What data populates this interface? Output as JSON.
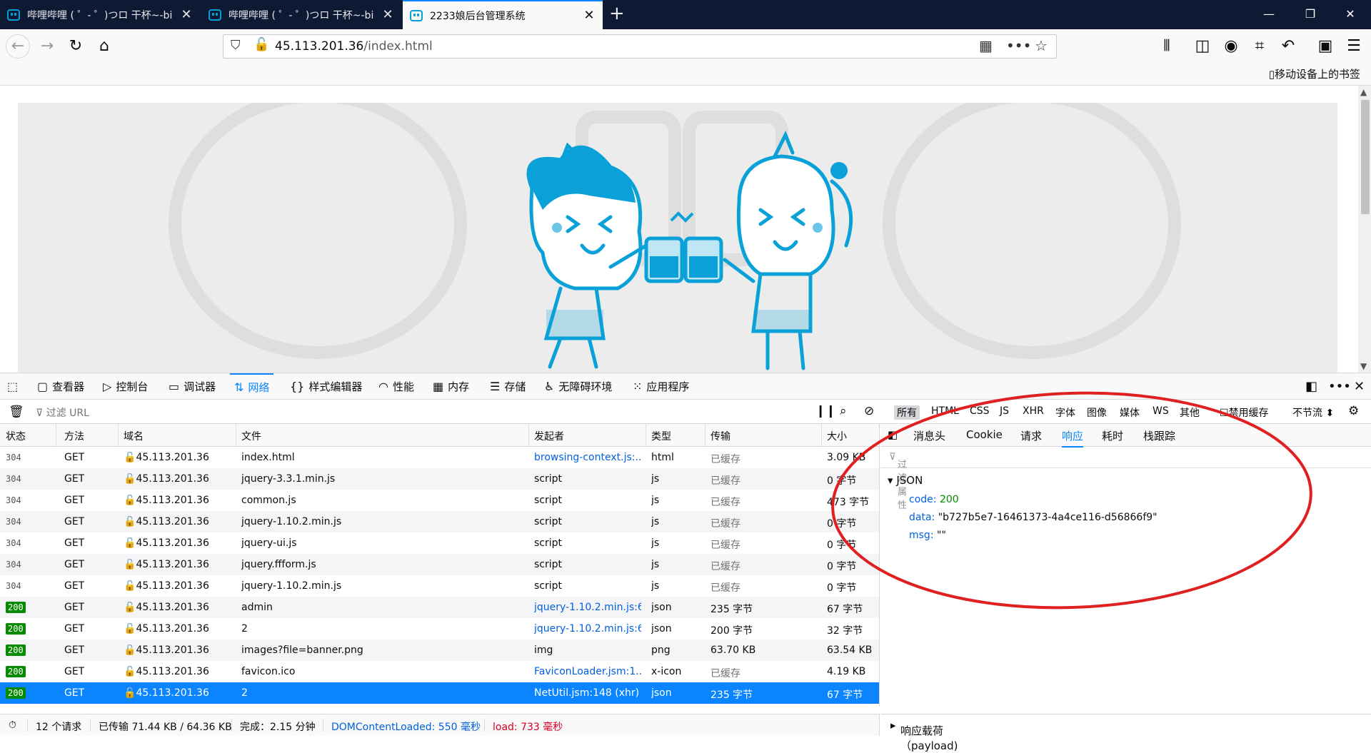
{
  "tabs": [
    {
      "title": "哔哩哔哩 ( ゜- ゜)つロ 干杯~-bi",
      "close": "✕"
    },
    {
      "title": "哔哩哔哩 ( ゜- ゜)つロ 干杯~-bi",
      "close": "✕"
    },
    {
      "title": "2233娘后台管理系统",
      "close": "✕"
    }
  ],
  "window_controls": {
    "minimize": "—",
    "restore": "❐",
    "close": "✕"
  },
  "nav": {
    "url_host": "45.113.201.36",
    "url_path": "/index.html"
  },
  "bookmarks": {
    "mobile": "移动设备上的书签"
  },
  "devtools": {
    "tabs": [
      "查看器",
      "控制台",
      "调试器",
      "网络",
      "样式编辑器",
      "性能",
      "内存",
      "存储",
      "无障碍环境",
      "应用程序"
    ],
    "filter_placeholder": "过滤 URL",
    "type_filters": [
      "所有",
      "HTML",
      "CSS",
      "JS",
      "XHR",
      "字体",
      "图像",
      "媒体",
      "WS",
      "其他"
    ],
    "disable_cache": "禁用缓存",
    "throttle": "不节流 ⬍",
    "columns": [
      "状态",
      "方法",
      "域名",
      "文件",
      "发起者",
      "类型",
      "传输",
      "大小"
    ],
    "requests": [
      {
        "status": "304",
        "method": "GET",
        "domain": "45.113.201.36",
        "file": "index.html",
        "initiator": "browsing-context.js:...",
        "type": "html",
        "transferred": "已缓存",
        "size": "3.09 KB"
      },
      {
        "status": "304",
        "method": "GET",
        "domain": "45.113.201.36",
        "file": "jquery-3.3.1.min.js",
        "initiator": "script",
        "type": "js",
        "transferred": "已缓存",
        "size": "0 字节"
      },
      {
        "status": "304",
        "method": "GET",
        "domain": "45.113.201.36",
        "file": "common.js",
        "initiator": "script",
        "type": "js",
        "transferred": "已缓存",
        "size": "473 字节"
      },
      {
        "status": "304",
        "method": "GET",
        "domain": "45.113.201.36",
        "file": "jquery-1.10.2.min.js",
        "initiator": "script",
        "type": "js",
        "transferred": "已缓存",
        "size": "0 字节"
      },
      {
        "status": "304",
        "method": "GET",
        "domain": "45.113.201.36",
        "file": "jquery-ui.js",
        "initiator": "script",
        "type": "js",
        "transferred": "已缓存",
        "size": "0 字节"
      },
      {
        "status": "304",
        "method": "GET",
        "domain": "45.113.201.36",
        "file": "jquery.ffform.js",
        "initiator": "script",
        "type": "js",
        "transferred": "已缓存",
        "size": "0 字节"
      },
      {
        "status": "304",
        "method": "GET",
        "domain": "45.113.201.36",
        "file": "jquery-1.10.2.min.js",
        "initiator": "script",
        "type": "js",
        "transferred": "已缓存",
        "size": "0 字节"
      },
      {
        "status": "200",
        "method": "GET",
        "domain": "45.113.201.36",
        "file": "admin",
        "initiator": "jquery-1.10.2.min.js:6...",
        "type": "json",
        "transferred": "235 字节",
        "size": "67 字节"
      },
      {
        "status": "200",
        "method": "GET",
        "domain": "45.113.201.36",
        "file": "2",
        "initiator": "jquery-1.10.2.min.js:6...",
        "type": "json",
        "transferred": "200 字节",
        "size": "32 字节"
      },
      {
        "status": "200",
        "method": "GET",
        "domain": "45.113.201.36",
        "file": "images?file=banner.png",
        "initiator": "img",
        "type": "png",
        "transferred": "63.70 KB",
        "size": "63.54 KB"
      },
      {
        "status": "200",
        "method": "GET",
        "domain": "45.113.201.36",
        "file": "favicon.ico",
        "initiator": "FaviconLoader.jsm:1...",
        "type": "x-icon",
        "transferred": "已缓存",
        "size": "4.19 KB"
      },
      {
        "status": "200",
        "method": "GET",
        "domain": "45.113.201.36",
        "file": "2",
        "initiator": "NetUtil.jsm:148 (xhr)",
        "type": "json",
        "transferred": "235 字节",
        "size": "67 字节"
      }
    ],
    "response_tabs": [
      "消息头",
      "Cookie",
      "请求",
      "响应",
      "耗时",
      "栈跟踪"
    ],
    "response_filter": "过滤属性",
    "json_label": "JSON",
    "json": [
      {
        "key": "code:",
        "value": "200"
      },
      {
        "key": "data:",
        "value": "\"b727b5e7-16461373-4a4ce116-d56866f9\""
      },
      {
        "key": "msg:",
        "value": "\"\""
      }
    ],
    "payload_label": "响应载荷（payload)",
    "status": {
      "requests": "12 个请求",
      "transferred": "已传输 71.44 KB / 64.36 KB",
      "finish": "完成：2.15 分钟",
      "dcl": "DOMContentLoaded: 550 毫秒",
      "load": "load: 733 毫秒"
    }
  },
  "colors": {
    "accent": "#0a84ff",
    "tabbar": "#0e1a34",
    "annotation": "#e02020",
    "status_ok": "#058b00"
  }
}
